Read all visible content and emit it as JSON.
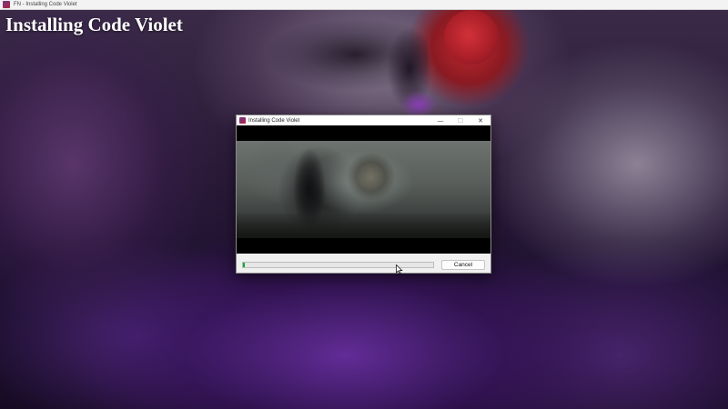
{
  "outer_window": {
    "title": "FN - Installing Code Violet"
  },
  "page": {
    "heading": "Installing Code Violet"
  },
  "dialog": {
    "title": "Installing Code Violet",
    "minimize_glyph": "—",
    "maximize_glyph": "☐",
    "close_glyph": "✕",
    "progress_percent": 0.8,
    "cancel_label": "Cancel"
  },
  "icons": {
    "outer_app": "app-icon",
    "dialog_app": "app-icon",
    "cursor": "mouse-pointer-icon"
  },
  "colors": {
    "progress_fill": "#06b025",
    "dialog_background": "#f0f0f0",
    "moon_accent": "#c0282e"
  }
}
